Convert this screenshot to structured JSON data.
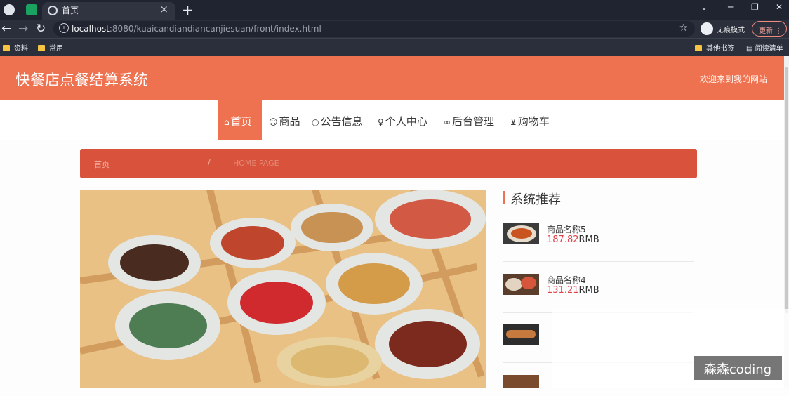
{
  "browser": {
    "tab_title": "首页",
    "url_host": "localhost",
    "url_path": ":8080/kuaicandiandiancanjiesuan/front/index.html",
    "incognito_label": "无痕模式",
    "update_label": "更新",
    "bookmarks": [
      "资料",
      "常用"
    ],
    "bookmarks_right": [
      "其他书签",
      "阅读清单"
    ]
  },
  "site": {
    "title": "快餐店点餐结算系统",
    "welcome": "欢迎来到我的网站"
  },
  "menu": [
    {
      "label": "首页",
      "icon": "home-icon",
      "active": true
    },
    {
      "label": "商品",
      "icon": "goods-icon",
      "active": false
    },
    {
      "label": "公告信息",
      "icon": "notice-icon",
      "active": false
    },
    {
      "label": "个人中心",
      "icon": "user-icon",
      "active": false
    },
    {
      "label": "后台管理",
      "icon": "link-icon",
      "active": false
    },
    {
      "label": "购物车",
      "icon": "cart-icon",
      "active": false
    }
  ],
  "breadcrumb": {
    "home": "首页",
    "separator": "/",
    "current": "HOME PAGE"
  },
  "recommend": {
    "title": "系统推荐",
    "unit": "RMB",
    "items": [
      {
        "name": "商品名称5",
        "price": "187.82"
      },
      {
        "name": "商品名称4",
        "price": "131.21"
      }
    ]
  },
  "watermark": "森森coding"
}
